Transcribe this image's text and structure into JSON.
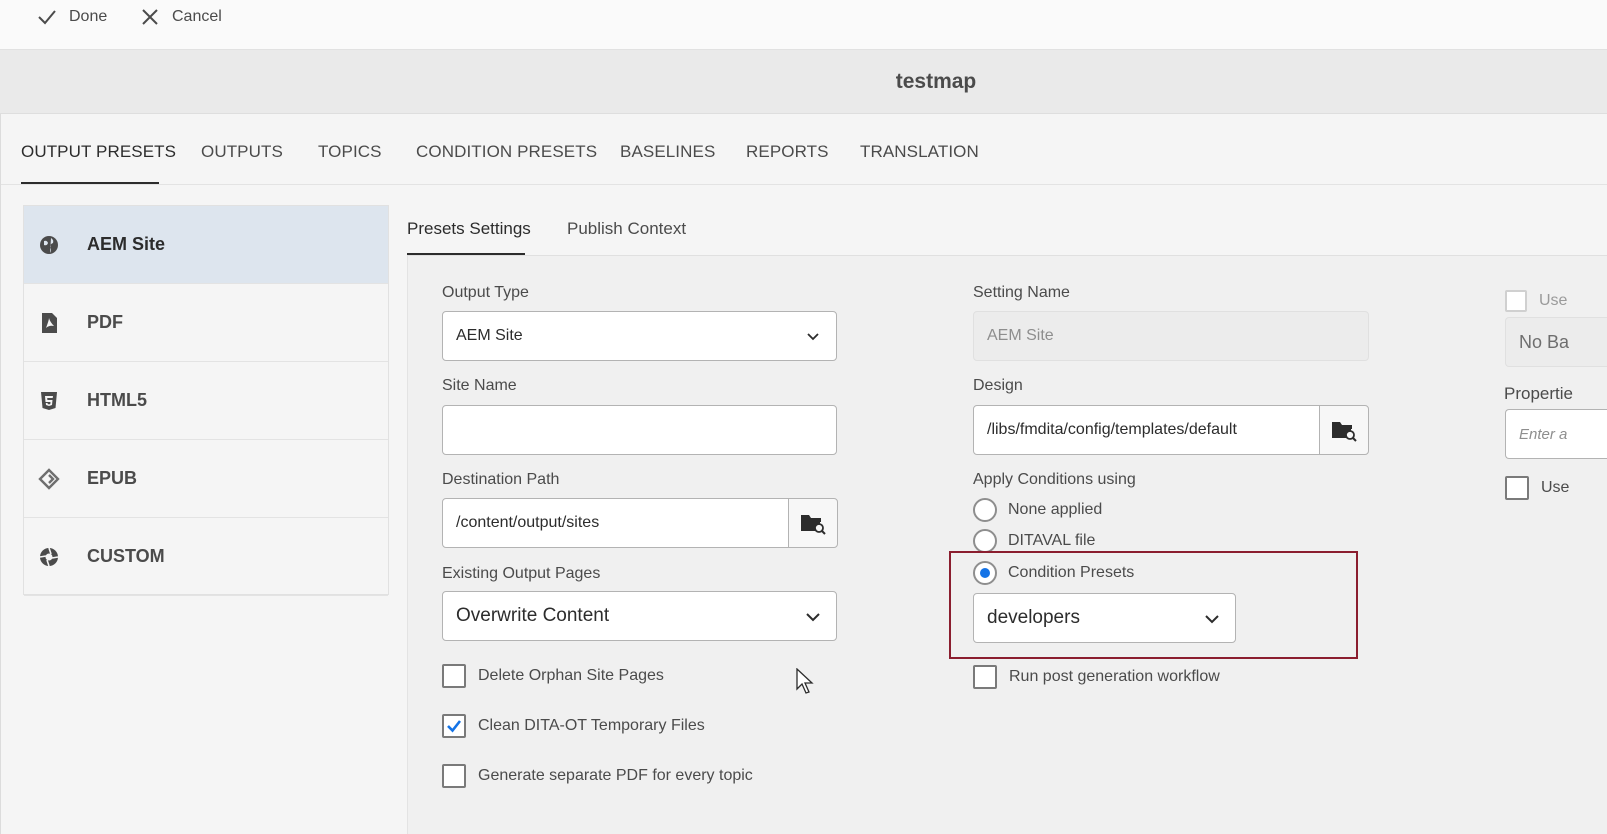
{
  "toolbar": {
    "done_label": "Done",
    "cancel_label": "Cancel"
  },
  "header": {
    "title": "testmap"
  },
  "tabs": [
    "OUTPUT PRESETS",
    "OUTPUTS",
    "TOPICS",
    "CONDITION PRESETS",
    "BASELINES",
    "REPORTS",
    "TRANSLATION"
  ],
  "sidebar": {
    "items": [
      {
        "label": "AEM Site",
        "icon": "globe-icon"
      },
      {
        "label": "PDF",
        "icon": "pdf-icon"
      },
      {
        "label": "HTML5",
        "icon": "html5-icon"
      },
      {
        "label": "EPUB",
        "icon": "epub-icon"
      },
      {
        "label": "CUSTOM",
        "icon": "aperture-icon"
      }
    ]
  },
  "subtabs": [
    "Presets Settings",
    "Publish Context"
  ],
  "form": {
    "output_type": {
      "label": "Output Type",
      "value": "AEM Site"
    },
    "site_name": {
      "label": "Site Name",
      "value": ""
    },
    "destination_path": {
      "label": "Destination Path",
      "value": "/content/output/sites"
    },
    "existing_output_pages": {
      "label": "Existing Output Pages",
      "value": "Overwrite Content"
    },
    "delete_orphan": {
      "label": "Delete Orphan Site Pages",
      "checked": false
    },
    "clean_temp": {
      "label": "Clean DITA-OT Temporary Files",
      "checked": true
    },
    "separate_pdf": {
      "label": "Generate separate PDF for every topic",
      "checked": false
    },
    "setting_name": {
      "label": "Setting Name",
      "value": "AEM Site"
    },
    "design": {
      "label": "Design",
      "value": "/libs/fmdita/config/templates/default"
    },
    "apply_conditions": {
      "label": "Apply Conditions using",
      "options": [
        "None applied",
        "DITAVAL file",
        "Condition Presets"
      ],
      "selected": "Condition Presets",
      "preset_value": "developers"
    },
    "post_workflow": {
      "label": "Run post generation workflow",
      "checked": false
    }
  },
  "right_panel": {
    "use_checkbox_1": "Use",
    "baseline_value": "No Ba",
    "properties_label": "Propertie",
    "properties_placeholder": "Enter a",
    "use_checkbox_2": "Use"
  },
  "colors": {
    "accent": "#1473e6",
    "highlight": "#8b1e2f",
    "active_item": "#dde5ee"
  }
}
